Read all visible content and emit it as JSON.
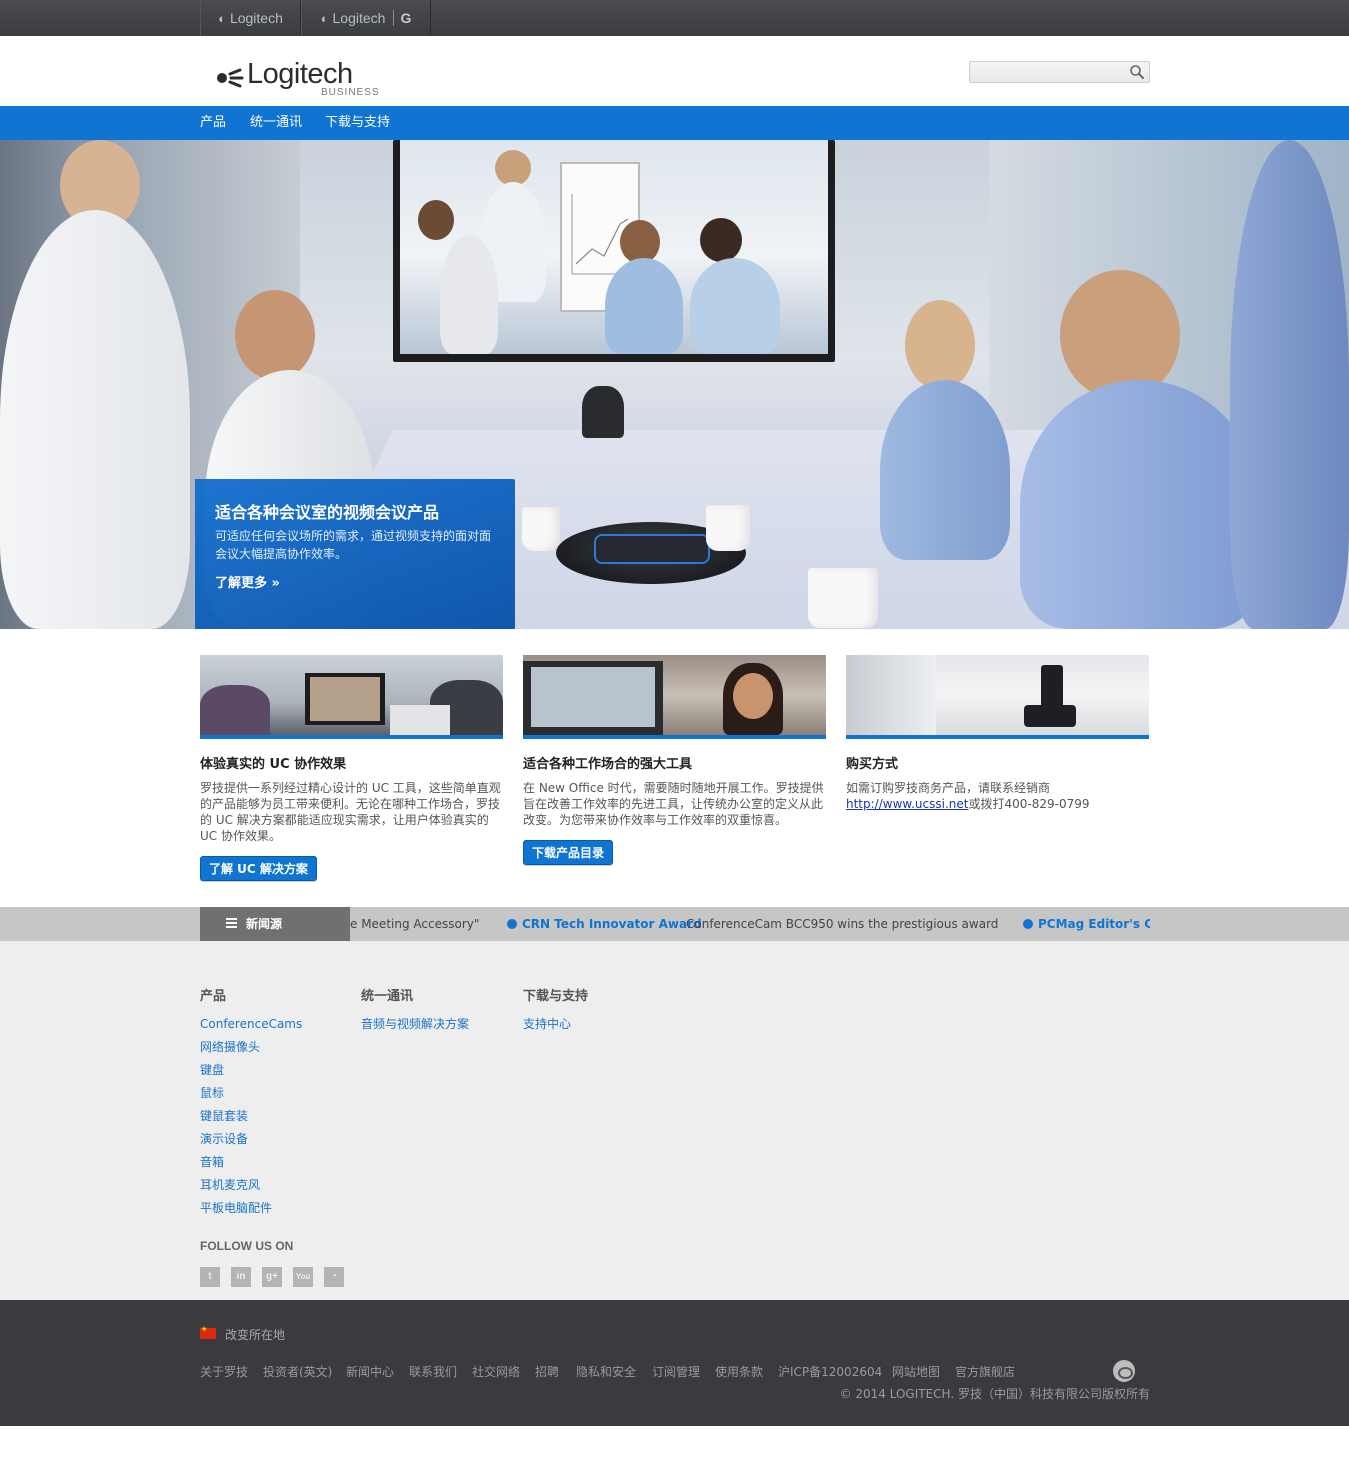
{
  "topbar": {
    "brands": [
      {
        "label": "Logitech"
      },
      {
        "label": "Logitech",
        "suffix": "G"
      }
    ]
  },
  "header": {
    "logo_word": "Logitech",
    "logo_sub": "BUSINESS",
    "search_placeholder": ""
  },
  "nav": {
    "items": [
      "产品",
      "统一通讯",
      "下载与支持"
    ]
  },
  "hero": {
    "title": "适合各种会议室的视频会议产品",
    "description": "可适应任何会议场所的需求，通过视频支持的面对面会议大幅提高协作效率。",
    "more": "了解更多 »"
  },
  "features": [
    {
      "title": "体验真实的 UC 协作效果",
      "description": "罗技提供一系列经过精心设计的 UC 工具，这些简单直观的产品能够为员工带来便利。无论在哪种工作场合，罗技的 UC 解决方案都能适应现实需求，让用户体验真实的 UC 协作效果。",
      "button": "了解 UC 解决方案"
    },
    {
      "title": "适合各种工作场合的强大工具",
      "description": "在 New Office 时代，需要随时随地开展工作。罗技提供旨在改善工作效率的先进工具，让传统办公室的定义从此改变。为您带来协作效率与工作效率的双重惊喜。",
      "button": "下载产品目录"
    },
    {
      "title": "购买方式",
      "description_prefix": "如需订购罗技商务产品，请联系经销商",
      "link": "http://www.ucssi.net",
      "description_suffix": "或拨打400-829-0799"
    }
  ],
  "news": {
    "label": "新闻源",
    "items": [
      {
        "text": "e Meeting Accessory\""
      },
      {
        "headline": "CRN Tech Innovator Award",
        "text": "ConferenceCam BCC950 wins the prestigious award"
      },
      {
        "headline": "PCMag Editor's Cho"
      }
    ]
  },
  "sitemap": {
    "columns": [
      {
        "heading": "产品",
        "links": [
          "ConferenceCams",
          "网络摄像头",
          "键盘",
          "鼠标",
          "键鼠套装",
          "演示设备",
          "音箱",
          "耳机麦克风",
          "平板电脑配件"
        ]
      },
      {
        "heading": "统一通讯",
        "links": [
          "音频与视频解决方案"
        ]
      },
      {
        "heading": "下载与支持",
        "links": [
          "支持中心"
        ]
      }
    ],
    "follow_label": "FOLLOW US ON",
    "social": [
      {
        "icon": "twitter-icon",
        "glyph": "t"
      },
      {
        "icon": "linkedin-icon",
        "glyph": "in"
      },
      {
        "icon": "googleplus-icon",
        "glyph": "g+"
      },
      {
        "icon": "youtube-icon",
        "glyph": "You"
      },
      {
        "icon": "rss-icon",
        "glyph": "◔"
      }
    ]
  },
  "footer": {
    "location": "改变所在地",
    "links": [
      "关于罗技",
      "投资者(英文)",
      "新闻中心",
      "联系我们",
      "社交网络",
      "招聘",
      "隐私和安全",
      "订阅管理",
      "使用条款",
      "沪ICP备12002604",
      "网站地图",
      "官方旗舰店"
    ],
    "copyright": "© 2014 LOGITECH. 罗技（中国）科技有限公司版权所有"
  },
  "colors": {
    "brand_blue": "#0f74d2",
    "topbar": "#3f4145",
    "footer": "#3a3b3e"
  }
}
